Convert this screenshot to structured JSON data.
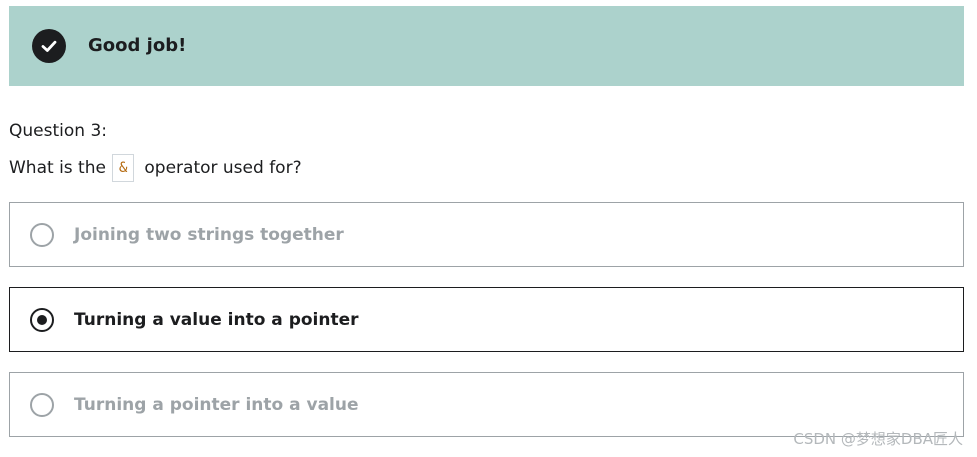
{
  "banner": {
    "icon": "check-circle-icon",
    "text": "Good job!",
    "background": "#acd2cc"
  },
  "question": {
    "number": "Question 3:",
    "text_before": "What is the",
    "code": "&",
    "text_after": "operator used for?"
  },
  "options": [
    {
      "label": "Joining two strings together",
      "selected": false
    },
    {
      "label": "Turning a value into a pointer",
      "selected": true
    },
    {
      "label": "Turning a pointer into a value",
      "selected": false
    }
  ],
  "watermark": "CSDN @梦想家DBA匠人"
}
